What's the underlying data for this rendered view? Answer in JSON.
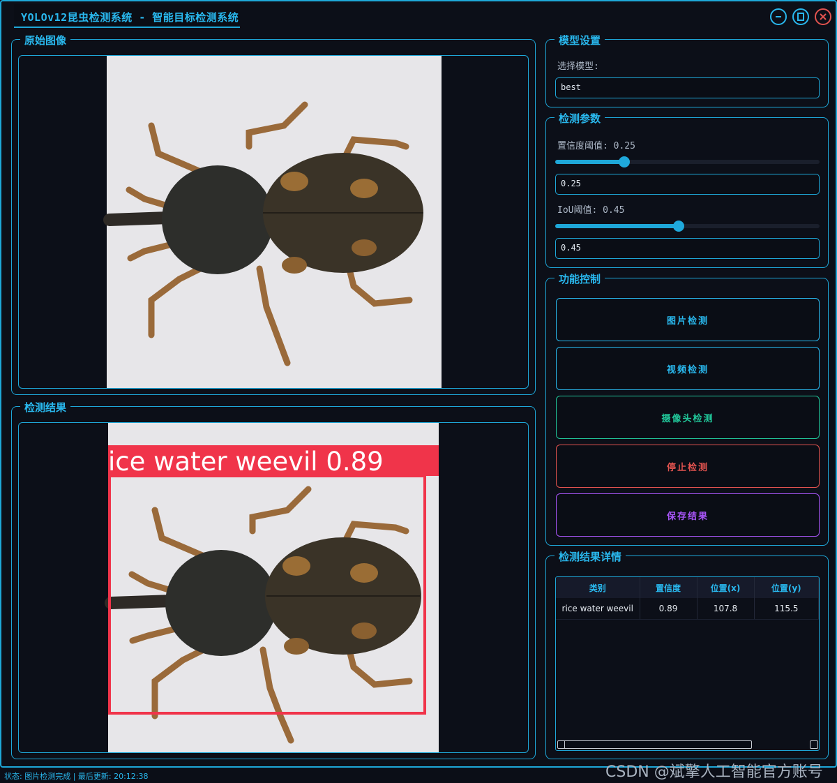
{
  "window": {
    "title": "YOLOv12昆虫检测系统 - 智能目标检测系统",
    "controls": [
      "minimize-icon",
      "maximize-icon",
      "close-icon"
    ]
  },
  "original_panel": {
    "title": "原始图像"
  },
  "result_panel": {
    "title": "检测结果",
    "detection_label": "ice water weevil 0.89",
    "box_color": "#f0344a"
  },
  "model_settings": {
    "title": "模型设置",
    "select_label": "选择模型:",
    "model_value": "best"
  },
  "detection_params": {
    "title": "检测参数",
    "confidence_label": "置信度阈值: 0.25",
    "confidence_value": 0.25,
    "confidence_input": "0.25",
    "iou_label": "IoU阈值: 0.45",
    "iou_value": 0.45,
    "iou_input": "0.45"
  },
  "function_controls": {
    "title": "功能控制",
    "buttons": [
      {
        "label": "图片检测",
        "color": "#29b8ee"
      },
      {
        "label": "视频检测",
        "color": "#29b8ee"
      },
      {
        "label": "摄像头检测",
        "color": "#21c79a"
      },
      {
        "label": "停止检测",
        "color": "#e2534f"
      },
      {
        "label": "保存结果",
        "color": "#a855f7"
      }
    ]
  },
  "results_table": {
    "title": "检测结果详情",
    "columns": [
      "类别",
      "置信度",
      "位置(x)",
      "位置(y)"
    ],
    "rows": [
      [
        "rice water weevil",
        "0.89",
        "107.8",
        "115.5"
      ]
    ]
  },
  "status_bar": {
    "text": "状态: 图片检测完成 | 最后更新: 20:12:38"
  },
  "watermark": "CSDN @斌擎人工智能官方账号",
  "colors": {
    "accent": "#1ea7d8",
    "background": "#0c0f18"
  }
}
